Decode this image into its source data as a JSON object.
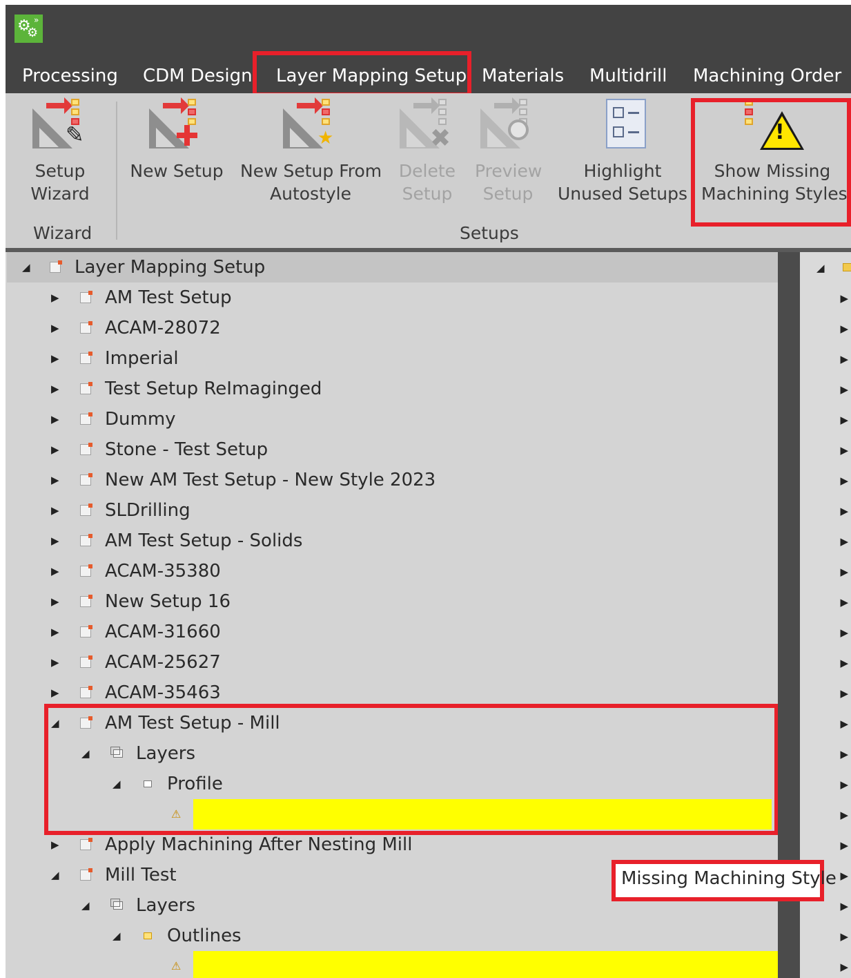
{
  "tabs": [
    "Processing",
    "CDM Design",
    "Layer Mapping Setup",
    "Materials",
    "Multidrill",
    "Machining Order"
  ],
  "ribbon": {
    "setup_wizard": {
      "line1": "Setup",
      "line2": "Wizard"
    },
    "new_setup": {
      "line1": "New Setup"
    },
    "new_setup_from_autostyle": {
      "line1": "New Setup From",
      "line2": "Autostyle"
    },
    "delete_setup": {
      "line1": "Delete",
      "line2": "Setup"
    },
    "preview_setup": {
      "line1": "Preview",
      "line2": "Setup"
    },
    "highlight_unused": {
      "line1": "Highlight",
      "line2": "Unused Setups"
    },
    "show_missing": {
      "line1": "Show Missing",
      "line2": "Machining Styles"
    },
    "group_wizard": "Wizard",
    "group_setups": "Setups"
  },
  "tree": {
    "root": "Layer Mapping Setup",
    "items": [
      "AM Test Setup",
      "ACAM-28072",
      "Imperial",
      "Test Setup ReImaginged",
      "Dummy",
      "Stone - Test Setup",
      "New AM Test Setup - New Style 2023",
      "SLDrilling",
      "AM Test Setup - Solids",
      "ACAM-35380",
      "New Setup 16",
      "ACAM-31660",
      "ACAM-25627",
      "ACAM-35463"
    ],
    "mill_setup": "AM Test Setup - Mill",
    "mill_layers": "Layers",
    "mill_profile": "Profile",
    "apply_nesting": "Apply Machining After Nesting Mill",
    "mill_test": "Mill Test",
    "mill_test_layers": "Layers",
    "mill_test_outlines": "Outlines"
  },
  "tooltip": "Missing Machining Style",
  "colors": {
    "highlight_red": "#e8202a",
    "missing_yellow": "#ffff00",
    "titlebar": "#434343"
  }
}
